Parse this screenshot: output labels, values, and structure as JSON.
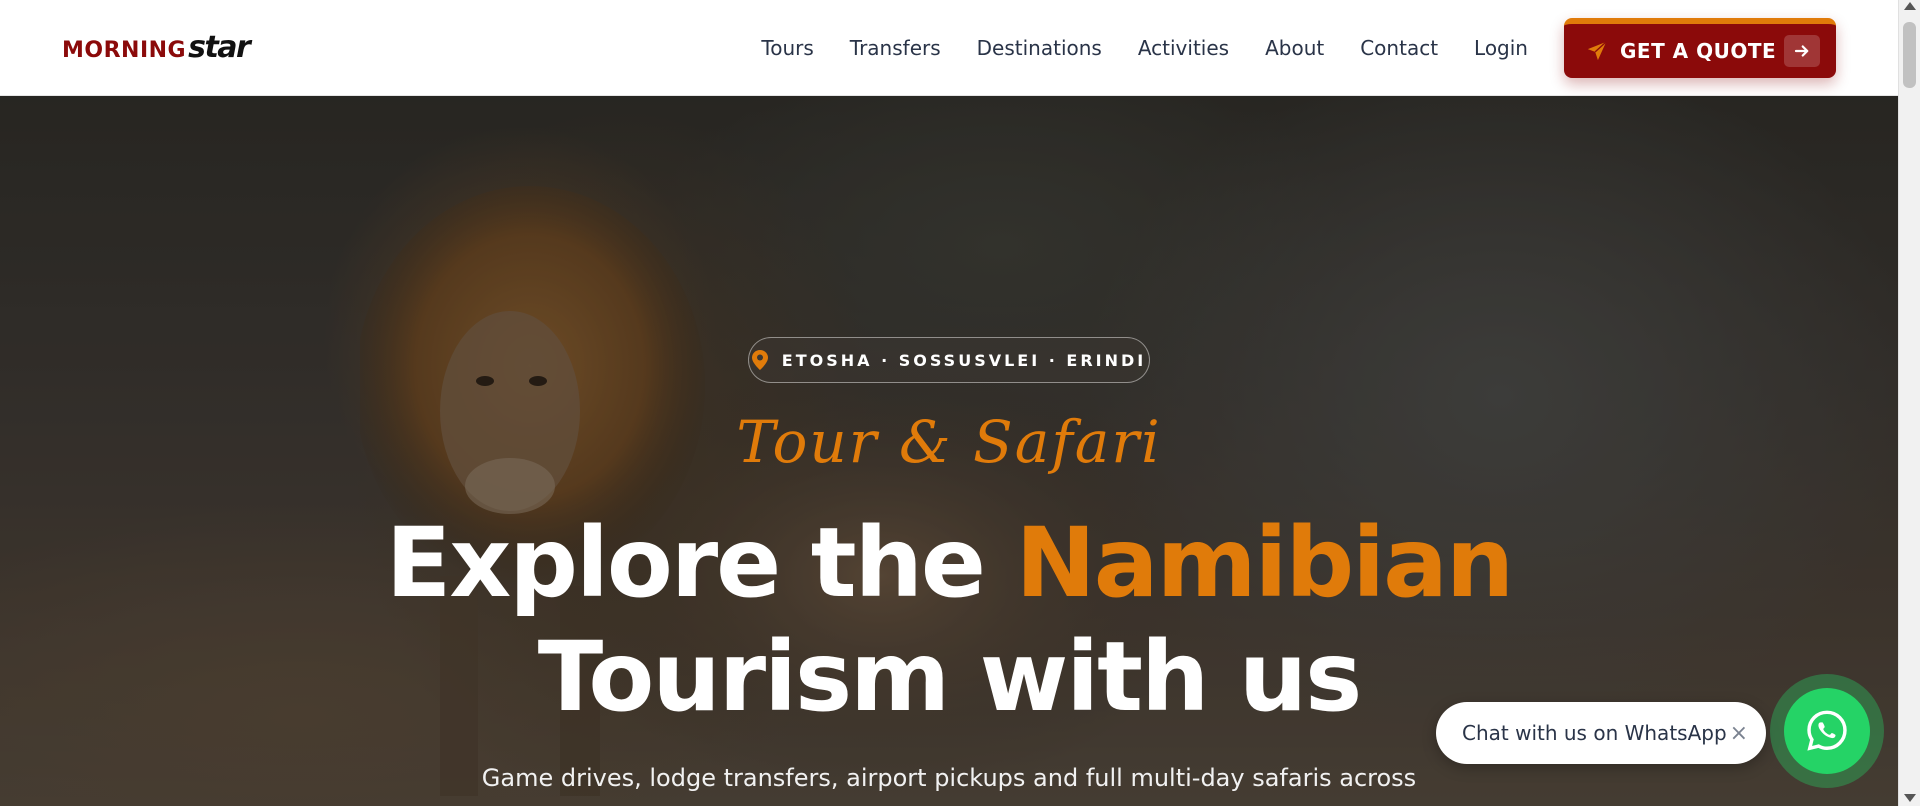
{
  "brand": {
    "logo_part1": "MORNING",
    "logo_part2": "star",
    "primary_color": "#8b0a0a",
    "accent_color": "#e07b0a"
  },
  "nav": {
    "links": [
      "Tours",
      "Transfers",
      "Destinations",
      "Activities",
      "About",
      "Contact",
      "Login"
    ],
    "cta_label": "GET A QUOTE",
    "cta_icon": "paper-plane-icon",
    "cta_arrow_icon": "arrow-right-icon"
  },
  "hero": {
    "locations": "ETOSHA · SOSSUSVLEI · ERINDI",
    "location_icon": "map-pin-icon",
    "script_title": "Tour & Safari",
    "headline_part1": "Explore the",
    "headline_accent": "Namibian",
    "headline_part2": "Tourism with us",
    "subtitle": "Game drives, lodge transfers, airport pickups and full multi-day safaris across"
  },
  "whatsapp": {
    "chat_label": "Chat with us on WhatsApp",
    "close_symbol": "×",
    "icon": "whatsapp-icon",
    "color": "#25d366"
  }
}
